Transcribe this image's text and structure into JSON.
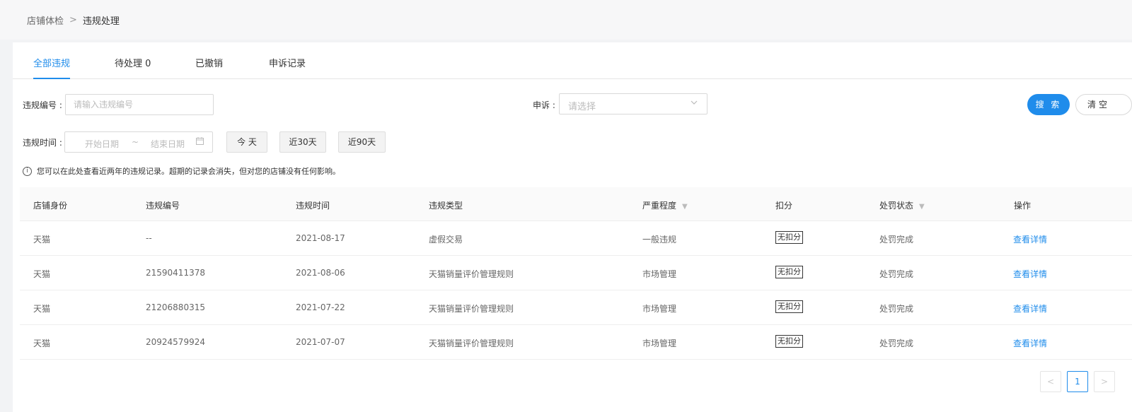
{
  "breadcrumb": {
    "parent": "店铺体检",
    "separator": ">",
    "current": "违规处理"
  },
  "tabs": [
    {
      "label": "全部违规"
    },
    {
      "label": "待处理 0"
    },
    {
      "label": "已撤销"
    },
    {
      "label": "申诉记录"
    }
  ],
  "filters": {
    "violation_no_label": "违规编号 :",
    "violation_no_placeholder": "请输入违规编号",
    "appeal_label": "申诉 :",
    "appeal_placeholder": "请选择",
    "time_label": "违规时间 :",
    "start_placeholder": "开始日期",
    "range_sep": "~",
    "end_placeholder": "结束日期",
    "quick": [
      "今 天",
      "近30天",
      "近90天"
    ],
    "search_label": "搜 索",
    "clear_label": "清空"
  },
  "notice": "您可以在此处查看近两年的违规记录。超期的记录会消失，但对您的店铺没有任何影响。",
  "table": {
    "headers": [
      "店铺身份",
      "违规编号",
      "违规时间",
      "违规类型",
      "严重程度",
      "扣分",
      "处罚状态",
      "操作"
    ],
    "rows": [
      {
        "identity": "天猫",
        "number": "--",
        "time": "2021-08-17",
        "type": "虚假交易",
        "severity": "一般违规",
        "points": "无扣分",
        "status": "处罚完成",
        "action": "查看详情"
      },
      {
        "identity": "天猫",
        "number": "21590411378",
        "time": "2021-08-06",
        "type": "天猫销量评价管理规则",
        "severity": "市场管理",
        "points": "无扣分",
        "status": "处罚完成",
        "action": "查看详情"
      },
      {
        "identity": "天猫",
        "number": "21206880315",
        "time": "2021-07-22",
        "type": "天猫销量评价管理规则",
        "severity": "市场管理",
        "points": "无扣分",
        "status": "处罚完成",
        "action": "查看详情"
      },
      {
        "identity": "天猫",
        "number": "20924579924",
        "time": "2021-07-07",
        "type": "天猫销量评价管理规则",
        "severity": "市场管理",
        "points": "无扣分",
        "status": "处罚完成",
        "action": "查看详情"
      }
    ]
  },
  "pagination": {
    "prev": "<",
    "current": "1",
    "next": ">"
  },
  "colors": {
    "accent": "#1f8ceb",
    "border": "#d9d9d9"
  }
}
